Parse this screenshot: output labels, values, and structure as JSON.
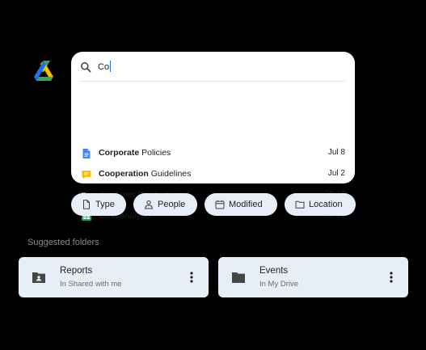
{
  "search": {
    "value": "Co"
  },
  "results": [
    {
      "bold": "Corporate",
      "rest": " Policies",
      "date": "Jul 8",
      "icon": "docs-icon",
      "color": "#4285f4"
    },
    {
      "bold": "Cooperation",
      "rest": " Guidelines",
      "date": "Jul 2",
      "icon": "chat-icon",
      "color": "#fbbc04"
    },
    {
      "pre": "Customer ",
      "bold": "Contacts",
      "date": "08:45",
      "icon": "folder-icon",
      "color": "#6b6b6b"
    },
    {
      "bold": "Cost",
      "rest": " Analysis",
      "date": "Jul 10",
      "icon": "sheets-icon",
      "color": "#34a853"
    }
  ],
  "chips": [
    {
      "label": "Type",
      "icon": "file-icon"
    },
    {
      "label": "People",
      "icon": "person-icon"
    },
    {
      "label": "Modified",
      "icon": "calendar-icon"
    },
    {
      "label": "Location",
      "icon": "folder-outline-icon"
    }
  ],
  "suggested": {
    "title": "Suggested folders",
    "folders": [
      {
        "name": "Reports",
        "location": "In Shared with me",
        "icon": "shared-folder-icon"
      },
      {
        "name": "Events",
        "location": "In My Drive",
        "icon": "folder-icon"
      }
    ]
  },
  "colors": {
    "background": "#000000",
    "panel": "#ffffff",
    "chip": "#e8eef7",
    "accent": "#1a73e8"
  }
}
